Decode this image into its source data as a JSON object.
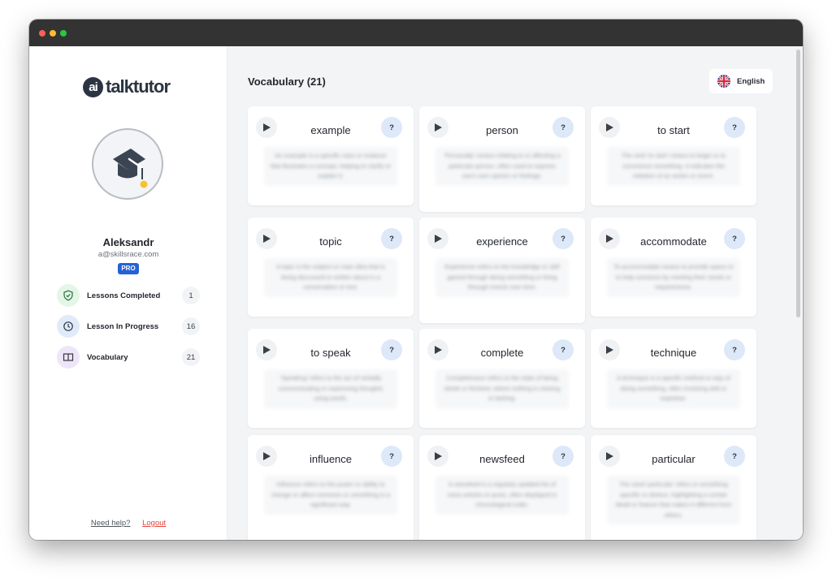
{
  "window": {
    "controls": [
      "close",
      "minimize",
      "maximize"
    ]
  },
  "sidebar": {
    "logo": {
      "badge": "ai",
      "text": "talktutor"
    },
    "avatar_icon": "graduation-cap-icon",
    "user": {
      "name": "Aleksandr",
      "email": "a@skillsrace.com",
      "plan": "PRO"
    },
    "stats": [
      {
        "icon": "shield-check-icon",
        "label": "Lessons Completed",
        "count": "1",
        "color": "#e3f6e8"
      },
      {
        "icon": "clock-icon",
        "label": "Lesson In Progress",
        "count": "16",
        "color": "#e1eaf9"
      },
      {
        "icon": "book-icon",
        "label": "Vocabulary",
        "count": "21",
        "color": "#ede6f8"
      }
    ],
    "footer": {
      "help": "Need help?",
      "logout": "Logout"
    }
  },
  "main": {
    "title": "Vocabulary (21)",
    "language": {
      "flag": "uk-flag-icon",
      "label": "English"
    },
    "help_label": "?",
    "cards": [
      {
        "word": "example",
        "definition": "An example is a specific case or instance that illustrates a concept, helping to clarify or explain it."
      },
      {
        "word": "person",
        "definition": "'Personally' means relating to or affecting a particular person, often used to express one's own opinion or feelings."
      },
      {
        "word": "to start",
        "definition": "The verb 'to start' means to begin or to commence something. It indicates the initiation of an action or event."
      },
      {
        "word": "topic",
        "definition": "A topic is the subject or main idea that is being discussed or written about in a conversation or text."
      },
      {
        "word": "experience",
        "definition": "Experience refers to the knowledge or skill gained through doing something or living through events over time."
      },
      {
        "word": "accommodate",
        "definition": "To accommodate means to provide space or to help someone by meeting their needs or requirements."
      },
      {
        "word": "to speak",
        "definition": "'Speaking' refers to the act of verbally communicating or expressing thoughts using words."
      },
      {
        "word": "complete",
        "definition": "Completeness refers to the state of being whole or finished, where nothing is missing or lacking."
      },
      {
        "word": "technique",
        "definition": "A technique is a specific method or way of doing something, often involving skill or expertise."
      },
      {
        "word": "influence",
        "definition": "Influence refers to the power or ability to change or affect someone or something in a significant way."
      },
      {
        "word": "newsfeed",
        "definition": "A newsfeed is a regularly updated list of news articles or posts, often displayed in chronological order."
      },
      {
        "word": "particular",
        "definition": "The word 'particular' refers to something specific or distinct, highlighting a certain detail or feature that makes it different from others."
      }
    ]
  }
}
